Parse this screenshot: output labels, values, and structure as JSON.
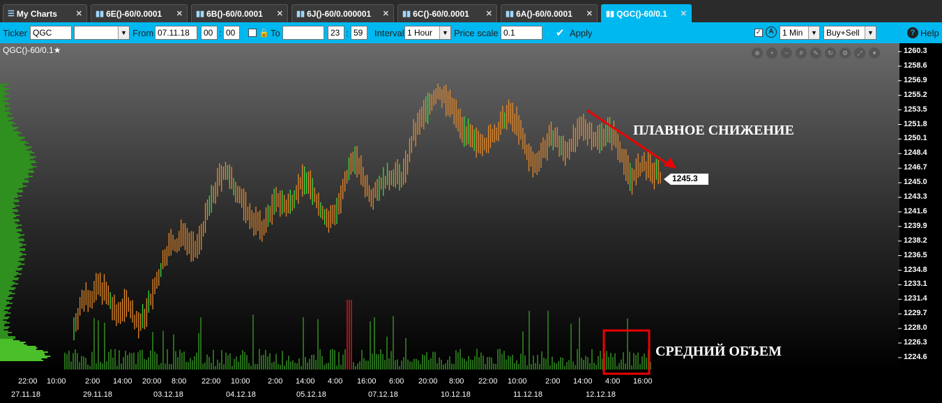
{
  "tabs": [
    {
      "label": "My Charts",
      "icon": "list-icon"
    },
    {
      "label": "6E()-60/0.0001",
      "icon": "bar-chart-icon"
    },
    {
      "label": "6B()-60/0.0001",
      "icon": "bar-chart-icon"
    },
    {
      "label": "6J()-60/0.000001",
      "icon": "bar-chart-icon"
    },
    {
      "label": "6C()-60/0.0001",
      "icon": "bar-chart-icon"
    },
    {
      "label": "6A()-60/0.0001",
      "icon": "bar-chart-icon"
    },
    {
      "label": "QGC()-60/0.1",
      "icon": "bar-chart-icon",
      "active": true
    }
  ],
  "toolbar": {
    "ticker_label": "Ticker",
    "ticker_value": "QGC",
    "from_label": "From",
    "from_date": "07.11.18",
    "from_hour": "00",
    "from_min": "00",
    "to_label": "To",
    "to_date": "",
    "to_hour": "23",
    "to_min": "59",
    "interval_label": "Interval",
    "interval_value": "1 Hour",
    "price_scale_label": "Price scale",
    "price_scale_value": "0.1",
    "apply_label": "Apply",
    "timeframe_value": "1 Min",
    "side_value": "Buy+Sell",
    "help_label": "Help"
  },
  "chart": {
    "title": "QGC()-60/0.1",
    "last_price": "1245.3",
    "annotation_trend": "ПЛАВНОЕ СНИЖЕНИЕ",
    "annotation_volume": "СРЕДНИЙ ОБЪЕМ"
  },
  "chart_data": {
    "type": "bar",
    "y_ticks": [
      "1260.3",
      "1258.6",
      "1256.9",
      "1255.2",
      "1253.5",
      "1251.8",
      "1250.1",
      "1248.4",
      "1246.7",
      "1245.0",
      "1243.3",
      "1241.6",
      "1239.9",
      "1238.2",
      "1236.5",
      "1234.8",
      "1233.1",
      "1231.4",
      "1229.7",
      "1228.0",
      "1226.3",
      "1224.6"
    ],
    "x_time_ticks": [
      "22:00",
      "10:00",
      "2:00",
      "14:00",
      "20:00",
      "8:00",
      "22:00",
      "10:00",
      "2:00",
      "14:00",
      "4:00",
      "16:00",
      "6:00",
      "20:00",
      "8:00",
      "22:00",
      "10:00",
      "2:00",
      "14:00",
      "4:00",
      "16:00"
    ],
    "x_date_ticks": [
      "27.11.18",
      "29.11.18",
      "03.12.18",
      "04.12.18",
      "05.12.18",
      "07.12.18",
      "10.12.18",
      "11.12.18",
      "12.12.18"
    ],
    "ylim": [
      1223.8,
      1261.0
    ],
    "close_path": [
      1228.0,
      1230.5,
      1232.0,
      1231.5,
      1233.0,
      1232.5,
      1231.0,
      1229.5,
      1230.5,
      1231.0,
      1229.0,
      1228.5,
      1230.0,
      1232.0,
      1234.0,
      1236.5,
      1238.0,
      1237.5,
      1239.5,
      1238.0,
      1237.0,
      1239.0,
      1241.5,
      1243.5,
      1245.5,
      1246.5,
      1245.0,
      1244.0,
      1242.5,
      1241.0,
      1240.5,
      1239.5,
      1241.0,
      1242.5,
      1243.0,
      1242.0,
      1243.0,
      1244.5,
      1245.5,
      1244.5,
      1243.0,
      1241.5,
      1240.5,
      1241.5,
      1243.0,
      1245.5,
      1248.0,
      1247.0,
      1245.0,
      1243.5,
      1244.5,
      1245.0,
      1245.5,
      1246.0,
      1245.5,
      1247.5,
      1250.5,
      1252.0,
      1253.5,
      1254.5,
      1255.5,
      1255.0,
      1254.0,
      1253.0,
      1251.5,
      1250.5,
      1249.5,
      1250.0,
      1249.5,
      1250.5,
      1251.0,
      1252.5,
      1253.0,
      1252.0,
      1250.0,
      1248.0,
      1247.0,
      1248.5,
      1249.5,
      1250.5,
      1249.5,
      1248.5,
      1249.5,
      1250.5,
      1251.5,
      1251.0,
      1250.0,
      1250.5,
      1251.0,
      1250.5,
      1249.0,
      1247.0,
      1245.5,
      1246.5,
      1247.0,
      1246.5,
      1246.0,
      1245.3
    ],
    "volume_note": "volume histogram bars"
  }
}
